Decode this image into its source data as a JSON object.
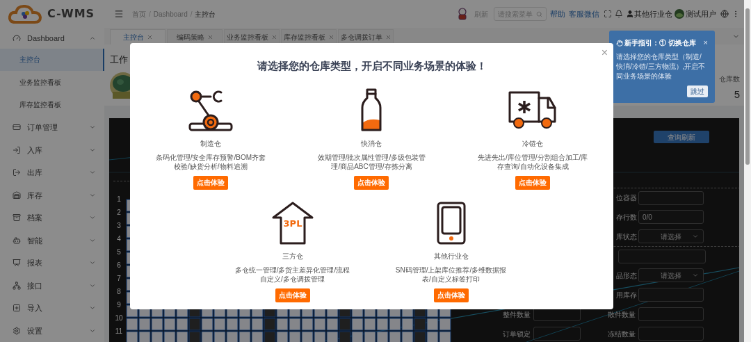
{
  "header": {
    "logo_text": "C-WMS",
    "breadcrumb": [
      "首页",
      "Dashboard",
      "主控台"
    ],
    "breadcrumb_separator": "/",
    "refresh": "刷新",
    "search": {
      "placeholder": "请搜索菜单"
    },
    "links": [
      "帮助",
      "客服微信"
    ],
    "warehouse": "其他行业仓",
    "user": "测试用户"
  },
  "sidebar": {
    "items": [
      {
        "label": "Dashboard",
        "expanded": true,
        "children": [
          {
            "label": "主控台",
            "selected": true
          },
          {
            "label": "业务监控看板",
            "selected": false
          },
          {
            "label": "库存监控看板",
            "selected": false
          }
        ]
      },
      {
        "label": "订单管理",
        "expanded": false
      },
      {
        "label": "入库",
        "expanded": false
      },
      {
        "label": "出库",
        "expanded": false
      },
      {
        "label": "库存",
        "expanded": false
      },
      {
        "label": "档案",
        "expanded": false
      },
      {
        "label": "智能",
        "expanded": false
      },
      {
        "label": "报表",
        "expanded": false
      },
      {
        "label": "接口",
        "expanded": false
      },
      {
        "label": "导入",
        "expanded": false
      },
      {
        "label": "设置",
        "expanded": false
      }
    ]
  },
  "tabs": [
    {
      "label": "主控台",
      "selected": true
    },
    {
      "label": "编码策略",
      "selected": false
    },
    {
      "label": "业务监控看板",
      "selected": false
    },
    {
      "label": "库存监控看板",
      "selected": false
    },
    {
      "label": "多仓调拨订单",
      "selected": false
    }
  ],
  "page": {
    "title": "工作",
    "stat": {
      "label": "仓库数",
      "value": "5"
    }
  },
  "panel": {
    "refresh_button": "查询刷新",
    "row_numbers": [
      "1",
      "2",
      "3",
      "4",
      "5",
      "6",
      "7",
      "8",
      "9",
      "10",
      "11"
    ],
    "form": [
      {
        "kind": "input",
        "label": "位容器"
      },
      {
        "kind": "input",
        "label": "存行数",
        "value": "0/0"
      },
      {
        "kind": "select",
        "label": "库状态",
        "value": "请选择"
      },
      {
        "kind": "wide-input"
      },
      {
        "kind": "select",
        "label": "品形态",
        "value": "请选择"
      },
      {
        "kind": "input",
        "label": "用库存"
      }
    ],
    "bottom_rows": [
      [
        "整件数量",
        "散件数量"
      ],
      [
        "订单锁定",
        "冻结数量"
      ]
    ]
  },
  "guide": {
    "title": "新手指引：① 切换仓库",
    "body": "请选择您的仓库类型（制造/快消/冷链/三方物流）,开启不同业务场景的体验",
    "close": "×",
    "skip": "跳过"
  },
  "modal": {
    "title": "请选择您的仓库类型，开启不同业务场景的体验！",
    "close": "×",
    "options": [
      {
        "kind": "robot-arm",
        "name": "制造仓",
        "description": "条码化管理/安全库存预警/BOM齐套校验/缺货分析/物料追溯",
        "button": "点击体验"
      },
      {
        "kind": "bottle",
        "name": "快消仓",
        "description": "效期管理/批次属性管理/多级包装管理/商品ABC管理/存拣分离",
        "button": "点击体验"
      },
      {
        "kind": "truck",
        "name": "冷链仓",
        "description": "先进先出/库位管理/分割组合加工/库存查询/自动化设备集成",
        "button": "点击体验"
      },
      {
        "kind": "house",
        "badge": "3PL",
        "name": "三方仓",
        "description": "多仓统一管理/多货主差异化管理/流程自定义/多仓调拨管理",
        "button": "点击体验"
      },
      {
        "kind": "tablet",
        "name": "其他行业仓",
        "description": "SN码管理/上架库位推荐/多维数据报表/自定义标签打印",
        "button": "点击体验"
      }
    ]
  }
}
